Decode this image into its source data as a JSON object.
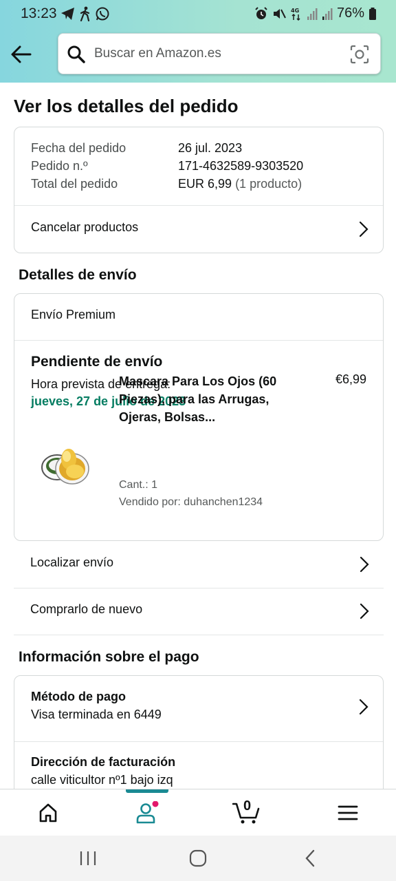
{
  "status": {
    "time": "13:23",
    "battery": "76%"
  },
  "search": {
    "placeholder": "Buscar en Amazon.es"
  },
  "page": {
    "title": "Ver los detalles del pedido"
  },
  "order": {
    "date_label": "Fecha del pedido",
    "date_value": "26 jul. 2023",
    "number_label": "Pedido n.º",
    "number_value": "171-4632589-9303520",
    "total_label": "Total del pedido",
    "total_value": "EUR 6,99",
    "total_count": "(1 producto)",
    "cancel_label": "Cancelar productos"
  },
  "shipping": {
    "section_title": "Detalles de envío",
    "service": "Envío Premium",
    "status": "Pendiente de envío",
    "eta_label": "Hora prevista de entrega:",
    "eta_value": "jueves, 27 de julio de 2023",
    "product_title": "Mascara Para Los Ojos (60 Piezas), para las Arrugas, Ojeras, Bolsas...",
    "product_price": "€6,99",
    "quantity": "Cant.: 1",
    "seller": "Vendido por: duhanchen1234"
  },
  "actions": {
    "track": "Localizar envío",
    "buy_again": "Comprarlo de nuevo"
  },
  "payment": {
    "section_title": "Información sobre el pago",
    "method_label": "Método de pago",
    "method_value": "Visa terminada en 6449",
    "billing_label": "Dirección de facturación",
    "billing_value": "calle viticultor nº1 bajo izq"
  },
  "nav": {
    "cart_count": "0",
    "icons": [
      "home-icon",
      "account-icon",
      "cart-icon",
      "menu-icon"
    ]
  },
  "colors": {
    "accent_teal": "#1a8a93",
    "delivery_green": "#067d62",
    "notification_pink": "#e3176b"
  }
}
